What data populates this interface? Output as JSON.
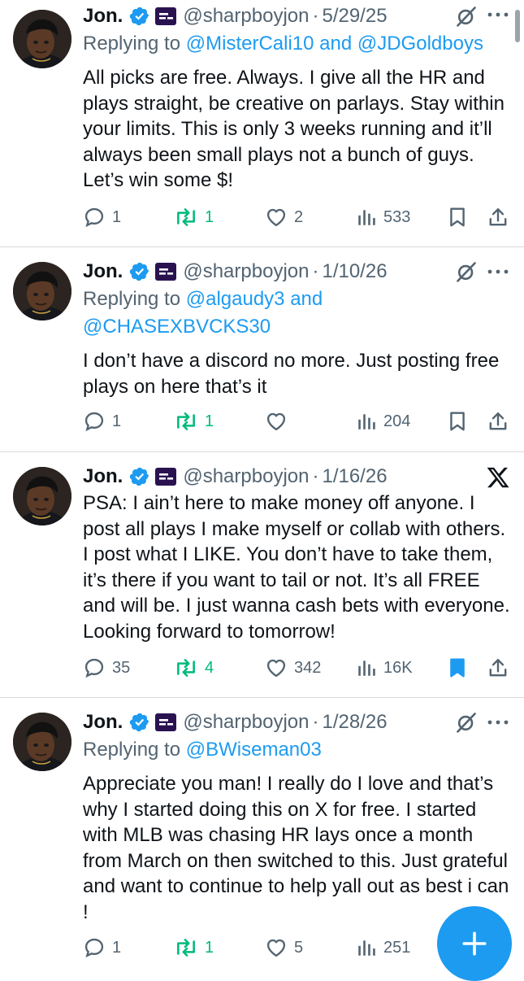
{
  "colors": {
    "accent": "#1d9bf0",
    "retweet": "#00ba7c",
    "muted": "#536471",
    "text": "#0f1419"
  },
  "tweets": [
    {
      "name": "Jon.",
      "handle": "@sharpboyjon",
      "sep": "·",
      "date": "5/29/25",
      "corner_icon": "grok-icon",
      "reply_prefix": "Replying to",
      "reply_line1": "@MisterCali10 and @JDGoldboys",
      "reply_line2": "",
      "text": "All picks are free. Always. I give all the HR and plays straight, be creative on parlays. Stay within your limits. This is only 3 weeks running and it’ll always been small plays not a bunch of guys. Let’s win some $!",
      "replies": "1",
      "retweets": "1",
      "likes": "2",
      "views": "533",
      "bookmarked": false
    },
    {
      "name": "Jon.",
      "handle": "@sharpboyjon",
      "sep": "·",
      "date": "1/10/26",
      "corner_icon": "grok-icon",
      "reply_prefix": "Replying to",
      "reply_line1": "@algaudy3 and",
      "reply_line2": "@CHASEXBVCKS30",
      "text": "I don’t have a discord no more. Just posting free plays on here that’s it",
      "replies": "1",
      "retweets": "1",
      "likes": "",
      "views": "204",
      "bookmarked": false
    },
    {
      "name": "Jon.",
      "handle": "@sharpboyjon",
      "sep": "·",
      "date": "1/16/26",
      "corner_icon": "x-logo-icon",
      "reply_prefix": "",
      "reply_line1": "",
      "reply_line2": "",
      "text": "PSA: I ain’t here to make money off anyone. I post all plays I make myself or collab with others. I post what I LIKE. You don’t have to take them, it’s there if you want to tail or not. It’s all FREE and will be. I just wanna cash bets with everyone. Looking forward to tomorrow!",
      "replies": "35",
      "retweets": "4",
      "likes": "342",
      "views": "16K",
      "bookmarked": true
    },
    {
      "name": "Jon.",
      "handle": "@sharpboyjon",
      "sep": "·",
      "date": "1/28/26",
      "corner_icon": "grok-icon",
      "reply_prefix": "Replying to",
      "reply_line1": "@BWiseman03",
      "reply_line2": "",
      "text": "Appreciate you man! I really do I love and that’s why I started doing this on X for free. I started with MLB was chasing HR lays once a month from March on then switched to this. Just grateful and want to continue to help yall out as best i can !",
      "replies": "1",
      "retweets": "1",
      "likes": "5",
      "views": "251",
      "bookmarked": false
    }
  ],
  "compose_button": {
    "icon": "plus-icon"
  }
}
